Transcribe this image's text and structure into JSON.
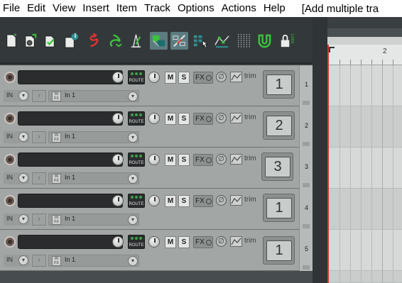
{
  "menu": {
    "items": [
      "File",
      "Edit",
      "View",
      "Insert",
      "Item",
      "Track",
      "Options",
      "Actions",
      "Help"
    ],
    "window_title": "[Add multiple tra"
  },
  "toolbar": {
    "buttons": [
      {
        "name": "new-project",
        "icon": "new-project-icon",
        "active": false
      },
      {
        "name": "open-project",
        "icon": "open-project-icon",
        "active": false
      },
      {
        "name": "save-project",
        "icon": "save-project-icon",
        "active": false
      },
      {
        "name": "project-settings",
        "icon": "project-info-icon",
        "active": false
      },
      {
        "name": "undo",
        "icon": "undo-icon",
        "active": false
      },
      {
        "name": "redo",
        "icon": "redo-icon",
        "active": false
      },
      {
        "name": "metronome",
        "icon": "metronome-icon",
        "active": false
      },
      {
        "name": "auto-crossfade",
        "icon": "crossfade-icon",
        "active": true
      },
      {
        "name": "ripple-editing",
        "icon": "ripple-icon",
        "active": true
      },
      {
        "name": "item-grouping",
        "icon": "grouping-icon",
        "active": false
      },
      {
        "name": "envelope-points",
        "icon": "envelope-points-icon",
        "active": false
      },
      {
        "name": "snap-grid",
        "icon": "grid-icon",
        "active": false
      },
      {
        "name": "snap-enable",
        "icon": "magnet-icon",
        "active": false
      },
      {
        "name": "lock",
        "icon": "lock-icon",
        "active": false
      }
    ],
    "info_badge": "i",
    "lock_badge": "LOCK"
  },
  "tracks": [
    {
      "number": "1",
      "meter_value": "1",
      "input_label": "IN",
      "input_select": "In 1",
      "route_label": "ROUTE",
      "mute_label": "M",
      "solo_label": "S",
      "fx_label": "FX",
      "trim_label": "trim",
      "infx_label": "IN FX"
    },
    {
      "number": "2",
      "meter_value": "2",
      "input_label": "IN",
      "input_select": "In 1",
      "route_label": "ROUTE",
      "mute_label": "M",
      "solo_label": "S",
      "fx_label": "FX",
      "trim_label": "trim",
      "infx_label": "IN FX"
    },
    {
      "number": "3",
      "meter_value": "3",
      "input_label": "IN",
      "input_select": "In 1",
      "route_label": "ROUTE",
      "mute_label": "M",
      "solo_label": "S",
      "fx_label": "FX",
      "trim_label": "trim",
      "infx_label": "IN FX"
    },
    {
      "number": "4",
      "meter_value": "1",
      "input_label": "IN",
      "input_select": "In 1",
      "route_label": "ROUTE",
      "mute_label": "M",
      "solo_label": "S",
      "fx_label": "FX",
      "trim_label": "trim",
      "infx_label": "IN FX"
    },
    {
      "number": "5",
      "meter_value": "1",
      "input_label": "IN",
      "input_select": "In 1",
      "route_label": "ROUTE",
      "mute_label": "M",
      "solo_label": "S",
      "fx_label": "FX",
      "trim_label": "trim",
      "infx_label": "IN FX"
    }
  ],
  "ruler": {
    "marker_label": "2"
  },
  "colors": {
    "accent": "#5c7d80",
    "play_cursor": "#d23a2c",
    "route_led": "#3f9e4a"
  }
}
